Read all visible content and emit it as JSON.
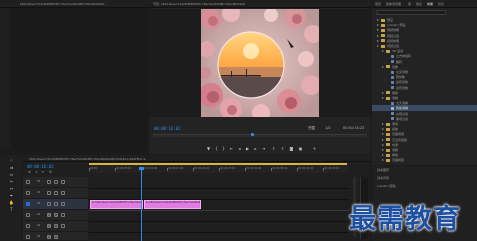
{
  "source_panel": {
    "tab_title": "b6b7abee71b4db9f6f0f45c76ec5ed9bd8fc1f0a48c69e8..."
  },
  "program_monitor": {
    "tab_title": "节目: b6b7abee71b4db9f6f0f45c76ec5ed9bd8fc1f0a48c69e8",
    "timecode_current": "00:00:16:02",
    "fit_label": "完整",
    "timecode_duration": "00:01:14:22",
    "quality": "1/2"
  },
  "project_panel": {
    "tabs": [
      "项目",
      "媒体浏览器",
      "库",
      "信息",
      "效果",
      "标记"
    ],
    "search_placeholder": "",
    "tree": [
      {
        "label": "预设",
        "level": 0,
        "folder": true
      },
      {
        "label": "Lumetri 预设",
        "level": 0,
        "folder": true
      },
      {
        "label": "音频效果",
        "level": 0,
        "folder": true
      },
      {
        "label": "音频过渡",
        "level": 0,
        "folder": true
      },
      {
        "label": "视频效果",
        "level": 0,
        "folder": true
      },
      {
        "label": "视频过渡",
        "level": 0,
        "folder": true
      },
      {
        "label": "3D 运动",
        "level": 1,
        "folder": true
      },
      {
        "label": "立方体旋转",
        "level": 2,
        "folder": false
      },
      {
        "label": "翻转",
        "level": 2,
        "folder": false
      },
      {
        "label": "划像",
        "level": 1,
        "folder": true
      },
      {
        "label": "交叉划像",
        "level": 2,
        "folder": false
      },
      {
        "label": "圆划像",
        "level": 2,
        "folder": false
      },
      {
        "label": "盒形划像",
        "level": 2,
        "folder": false
      },
      {
        "label": "菱形划像",
        "level": 2,
        "folder": false
      },
      {
        "label": "擦除",
        "level": 1,
        "folder": true
      },
      {
        "label": "溶解",
        "level": 1,
        "folder": true
      },
      {
        "label": "交叉溶解",
        "level": 2,
        "folder": false
      },
      {
        "label": "叠加溶解",
        "level": 2,
        "folder": false,
        "selected": true
      },
      {
        "label": "白场过渡",
        "level": 2,
        "folder": false
      },
      {
        "label": "黑场过渡",
        "level": 2,
        "folder": false
      },
      {
        "label": "滑动",
        "level": 1,
        "folder": true
      },
      {
        "label": "缩放",
        "level": 1,
        "folder": true
      },
      {
        "label": "页面剥落",
        "level": 1,
        "folder": true
      },
      {
        "label": "沉浸式视频",
        "level": 1,
        "folder": true
      },
      {
        "label": "内滑",
        "level": 1,
        "folder": true
      },
      {
        "label": "溶解",
        "level": 1,
        "folder": true
      },
      {
        "label": "擦除",
        "level": 1,
        "folder": true
      },
      {
        "label": "页面剥落",
        "level": 1,
        "folder": true
      }
    ],
    "bottom_items": [
      "基本图形",
      "基本声音",
      "Lumetri 颜色"
    ]
  },
  "timeline": {
    "tab_title": "b6b7abee71b4db9f6f0f45c76ec5ed9bd8fc1f0a48c69e8b3ddd4a1c9e4f3b2 ≡",
    "timecode": "00:00:16:02",
    "ruler_labels": [
      "00:00",
      "00:00:05:00",
      "00:00:10:00",
      "00:00:15:00",
      "00:00:20:00",
      "00:00:25:00",
      "00:00:30:00",
      "00:00:35:00",
      "00:00:40:00",
      "00:00:45:00"
    ],
    "tracks": [
      {
        "id": "V3",
        "kind": "video"
      },
      {
        "id": "V2",
        "kind": "video"
      },
      {
        "id": "V1",
        "kind": "video"
      },
      {
        "id": "A1",
        "kind": "audio"
      },
      {
        "id": "A2",
        "kind": "audio"
      },
      {
        "id": "A3",
        "kind": "audio"
      }
    ],
    "clips": [
      {
        "label": "fx b6b7abee71b4db9f6f0f45c76ec5ed9",
        "track": "V1"
      },
      {
        "label": "fx b6b7abee71b4db9f6f0f45c76ec5ed9bd8f",
        "track": "V1"
      }
    ]
  },
  "watermark": {
    "text": "最需教育"
  },
  "colors": {
    "timecode": "#2d8ceb",
    "clip": "#e07be0",
    "selection": "#3a4a63",
    "playhead": "#2d8ceb",
    "work_area": "#d9b43a"
  }
}
